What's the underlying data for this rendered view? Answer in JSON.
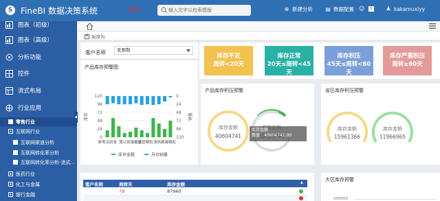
{
  "app": {
    "title": "FineBI 数据决策系统",
    "red_tag": "管理版"
  },
  "search": {
    "placeholder": "输入文字以检索模版"
  },
  "topbar": {
    "new_analysis": "新建分析",
    "data_config": "数据配置",
    "messages_count": "0",
    "username": "kakamuxiyy"
  },
  "sidebar": {
    "items": [
      {
        "label": "图表（初级）",
        "icon": "chart-icon"
      },
      {
        "label": "图表（高级）",
        "icon": "chart-icon"
      },
      {
        "label": "分析功能",
        "icon": "analysis-icon"
      },
      {
        "label": "控件",
        "icon": "widget-icon"
      },
      {
        "label": "流式布局",
        "icon": "layout-icon"
      },
      {
        "label": "行业应用",
        "icon": "industry-icon"
      }
    ],
    "subitems": [
      {
        "label": "零售行业",
        "type": "file"
      },
      {
        "label": "互联网行业",
        "type": "minus"
      },
      {
        "label": "互联网渠道分析",
        "type": "file"
      },
      {
        "label": "互联网转化率分析",
        "type": "file"
      },
      {
        "label": "互联网转化率分析-流式...",
        "type": "file"
      },
      {
        "label": "医药行业",
        "type": "plus"
      },
      {
        "label": "化工与金属",
        "type": "plus"
      },
      {
        "label": "银行金融",
        "type": "plus"
      }
    ]
  },
  "toolbar": {
    "save_as": "另存为"
  },
  "filter": {
    "label": "客户名称",
    "value": "无限制"
  },
  "kpis": [
    {
      "line1": "库存不足",
      "line2": "周转<20天",
      "color": "#f2c250"
    },
    {
      "line1": "库存正常",
      "line2": "20天≤周转<45天",
      "color": "#2ab1a6"
    },
    {
      "line1": "库存积压",
      "line2": "45天≤周转<60天",
      "color": "#7b9fd9"
    },
    {
      "line1": "库存严重积压",
      "line2": "周转≥60天",
      "color": "#e59a9a"
    }
  ],
  "chart_card": {
    "title": "产品库存预警图"
  },
  "chart_data": {
    "type": "bar",
    "categories": [
      "参零注射液",
      "",
      "",
      "",
      "蒲公英注射液",
      "",
      "小儿感冒颗粒",
      "",
      "",
      "",
      "清热解毒颗粒",
      ""
    ],
    "series": [
      {
        "name": "库存金额",
        "values": [
          5,
          14,
          8,
          3,
          4,
          7,
          5,
          3,
          14,
          10,
          6,
          12
        ],
        "color": "#3db54a"
      },
      {
        "name": "月均销量",
        "values": [
          24,
          21,
          24,
          24,
          24,
          21,
          26,
          24,
          26,
          24,
          16,
          4
        ],
        "color": "#29a3dd"
      }
    ],
    "left_axis": {
      "ticks": [
        "120",
        "96",
        "72",
        "48",
        "24",
        "0"
      ],
      "label": "库存"
    },
    "right_axis": {
      "ticks": [
        "0",
        "24",
        "48",
        "72",
        "96",
        "120"
      ],
      "label": "销量"
    },
    "legend": [
      "库存金额",
      "月均销量"
    ],
    "legend_position": "bottom"
  },
  "product_card": {
    "title": "产品库存积压预警",
    "gauges": [
      {
        "label": "库存金额",
        "value": "40604741"
      },
      {
        "label": "库存金额",
        "value": "40604741"
      }
    ],
    "tooltip": {
      "line1": "库存金额",
      "line2": "数值：40604741.00"
    }
  },
  "province_card": {
    "title": "省区库存积压预警",
    "gauges": [
      {
        "label": "库存金额",
        "value": "15961366"
      },
      {
        "label": "库存金额",
        "value": "11966965"
      }
    ]
  },
  "table": {
    "columns": [
      "客户名称",
      "周转天",
      "库存金额"
    ],
    "rows": [
      {
        "name": "",
        "days": "79",
        "amount": "87960"
      }
    ]
  },
  "region_card": {
    "title": "大区库存预警",
    "axis_tick": "200000"
  }
}
